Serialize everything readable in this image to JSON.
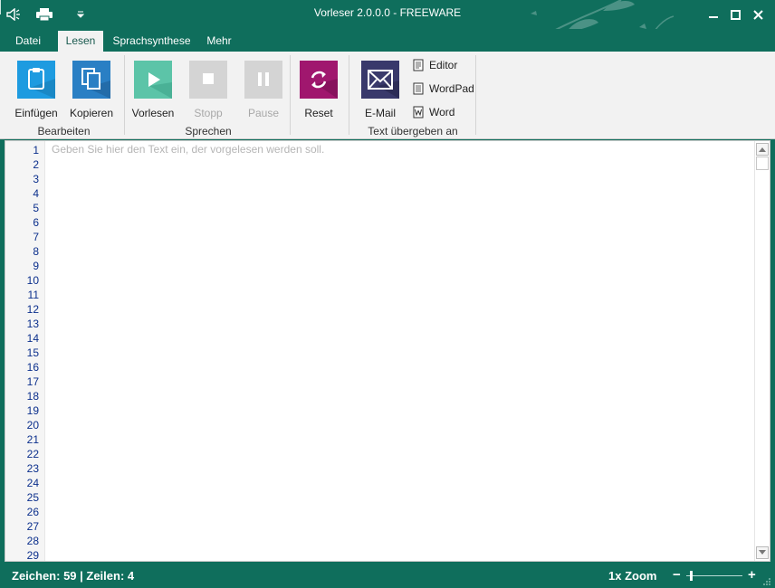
{
  "window": {
    "title": "Vorleser 2.0.0.0  -  FREEWARE"
  },
  "tabs": [
    {
      "label": "Datei"
    },
    {
      "label": "Lesen",
      "active": true
    },
    {
      "label": "Sprachsynthese"
    },
    {
      "label": "Mehr"
    }
  ],
  "ribbon": {
    "bearbeiten": {
      "label": "Bearbeiten",
      "paste": "Einfügen",
      "copy": "Kopieren"
    },
    "sprechen": {
      "label": "Sprechen",
      "read": "Vorlesen",
      "stop": "Stopp",
      "pause": "Pause"
    },
    "reset": "Reset",
    "text_uebergeben": {
      "label": "Text übergeben an",
      "email": "E-Mail",
      "editor": "Editor",
      "wordpad": "WordPad",
      "word": "Word"
    }
  },
  "editor": {
    "placeholder": "Geben Sie hier den Text ein, der vorgelesen werden soll.",
    "line_numbers": [
      "1",
      "2",
      "3",
      "4",
      "5",
      "6",
      "7",
      "8",
      "9",
      "10",
      "11",
      "12",
      "13",
      "14",
      "15",
      "16",
      "17",
      "18",
      "19",
      "20",
      "21",
      "22",
      "23",
      "24",
      "25",
      "26",
      "27",
      "28",
      "29"
    ]
  },
  "status": {
    "counts": "Zeichen:  59 | Zeilen:  4",
    "zoom": "1x Zoom",
    "zoom_minus": "−",
    "zoom_plus": "+"
  },
  "colors": {
    "accent": "#0f6e5c",
    "paste_blue": "#1e9be0",
    "copy_blue": "#2a7fc4",
    "play_teal": "#5cc4a8",
    "reset_magenta": "#a0176e",
    "email_navy": "#39396b",
    "line_number": "#0b2f8c"
  }
}
